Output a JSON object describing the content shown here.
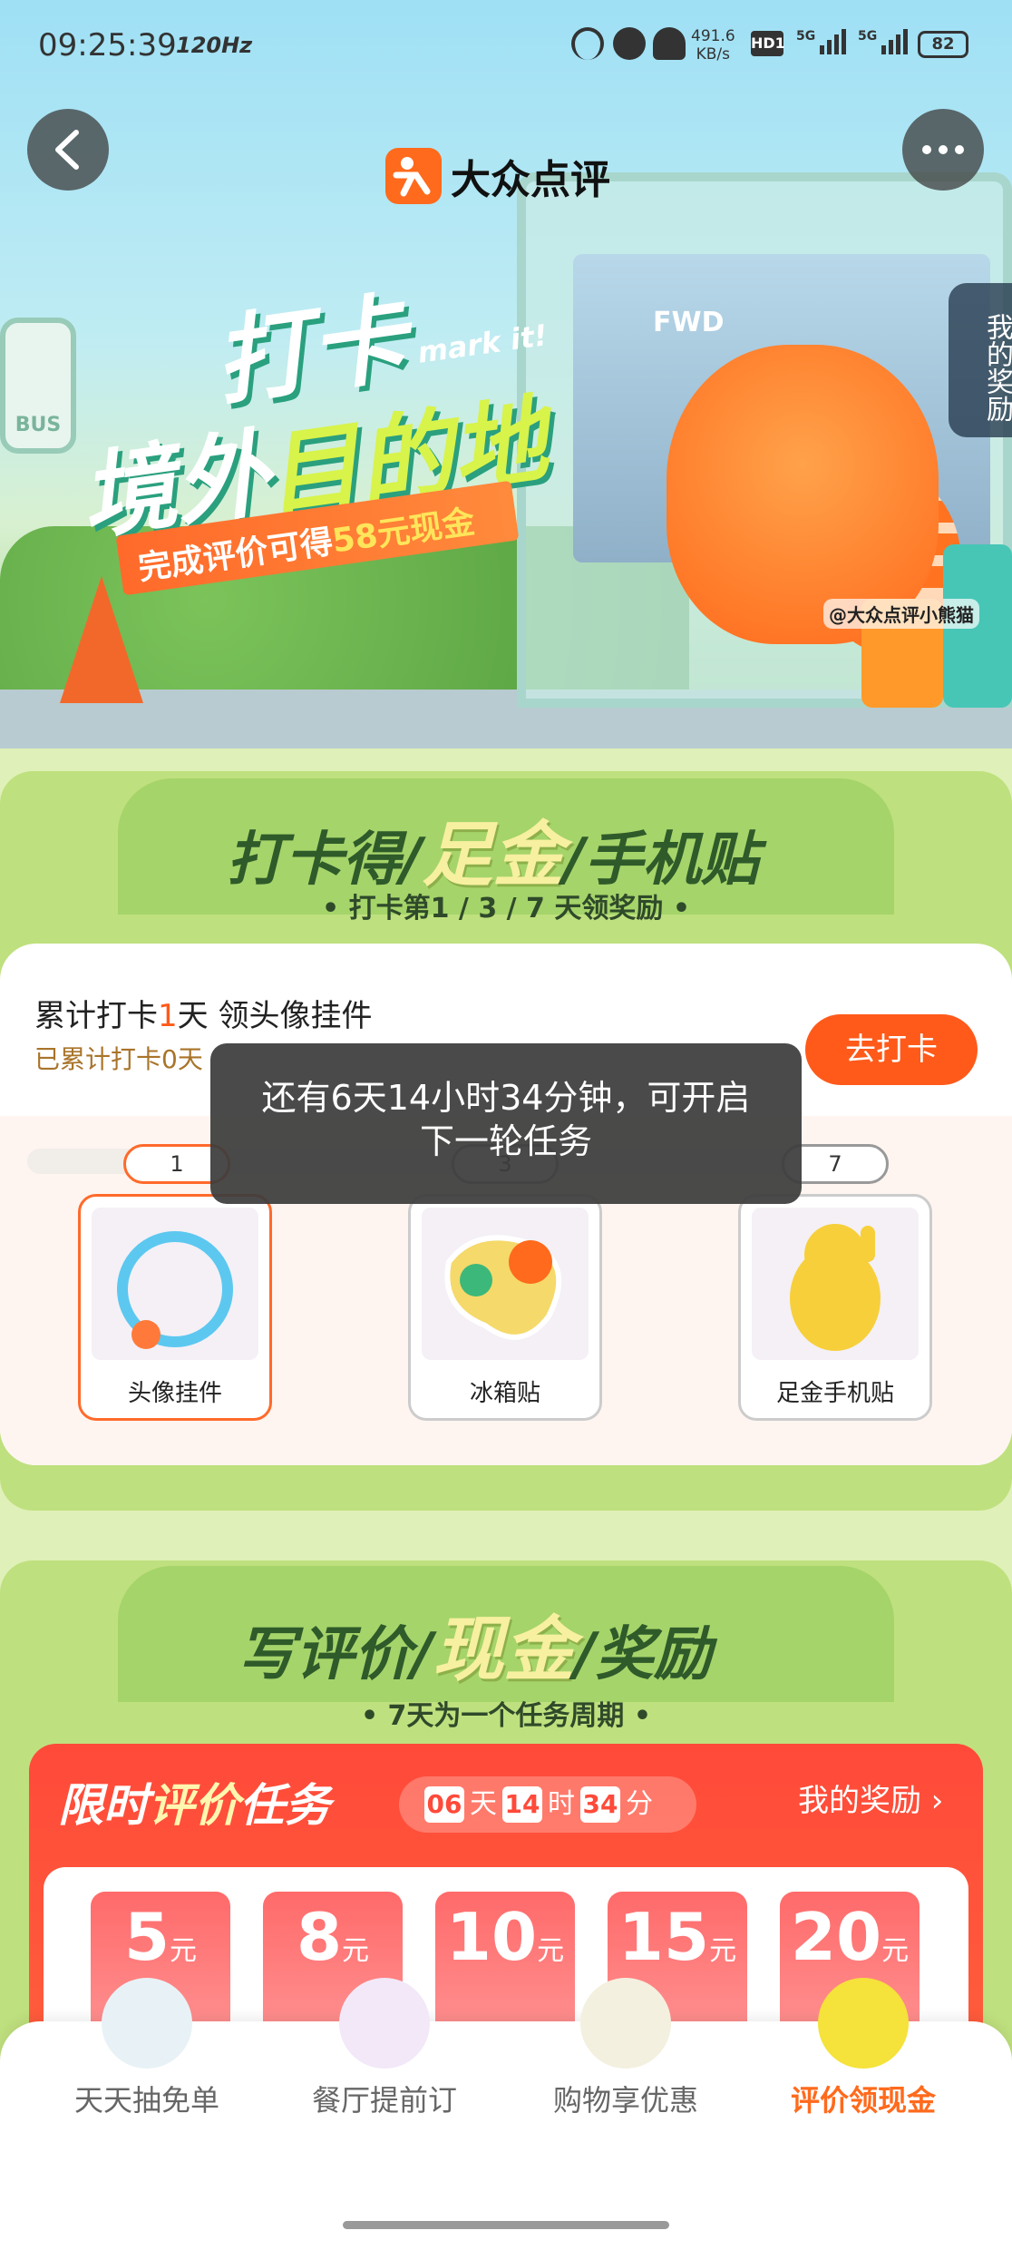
{
  "status_bar": {
    "time": "09:25:39",
    "refresh_rate": "120Hz",
    "net_speed_value": "491.6",
    "net_speed_unit": "KB/s",
    "hd_label": "HD1",
    "sim1": "5G",
    "sim2": "5G",
    "battery": "82"
  },
  "header": {
    "app_name": "大众点评",
    "my_reward_tab": "我的奖励"
  },
  "banner": {
    "headline_1": "打卡",
    "mark_it": "mark it!",
    "headline_2a": "境外",
    "headline_2b": "目的地",
    "ribbon_prefix": "完成评价可得",
    "ribbon_highlight": "58元现金",
    "shelter_logo": "FWD",
    "bus_sign": "BUS",
    "credit": "@大众点评小熊猫"
  },
  "checkin_section": {
    "title_a": "打卡得",
    "title_gold": "足金",
    "title_b": "手机贴",
    "subtitle": "• 打卡第1 / 3 / 7 天领奖励 •",
    "task_prefix": "累计打卡",
    "task_num": "1",
    "task_suffix": "天 领头像挂件",
    "task_sub": "已累计打卡0天",
    "checkin_button": "去打卡",
    "days": [
      "1",
      "3",
      "7"
    ],
    "rewards": [
      "头像挂件",
      "冰箱贴",
      "足金手机贴"
    ]
  },
  "toast": {
    "message": "还有6天14小时34分钟，可开启下一轮任务"
  },
  "review_section": {
    "title_a": "写评价",
    "title_gold": "现金",
    "title_b": "奖励",
    "subtitle": "• 7天为一个任务周期 •",
    "limited_a": "限时",
    "limited_b": "评价",
    "limited_c": "任务",
    "countdown": {
      "days": "06",
      "days_unit": "天",
      "hours": "14",
      "hours_unit": "时",
      "minutes": "34",
      "minutes_unit": "分"
    },
    "my_reward_link": "我的奖励 ›",
    "coupons": [
      {
        "amount": "5",
        "unit": "元"
      },
      {
        "amount": "8",
        "unit": "元"
      },
      {
        "amount": "10",
        "unit": "元"
      },
      {
        "amount": "15",
        "unit": "元"
      },
      {
        "amount": "20",
        "unit": "元"
      }
    ]
  },
  "bottom_nav": {
    "items": [
      "天天抽免单",
      "餐厅提前订",
      "购物享优惠",
      "评价领现金"
    ],
    "active_index": 3
  },
  "colors": {
    "brand_orange": "#ff5a1a",
    "section_green": "#bfe07e",
    "review_red": "#ff4a3a"
  }
}
